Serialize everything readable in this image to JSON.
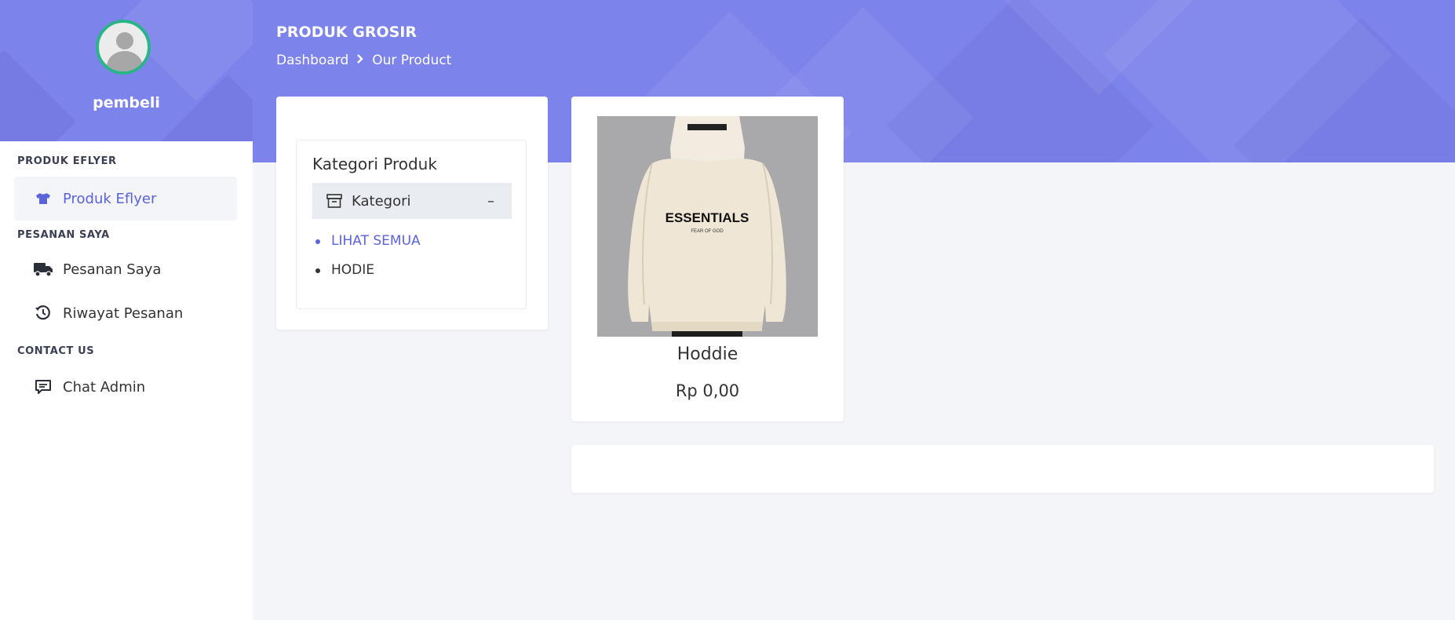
{
  "sidebar": {
    "username": "pembeli",
    "sections": [
      {
        "title": "PRODUK EFLYER"
      },
      {
        "title": "PESANAN SAYA"
      },
      {
        "title": "CONTACT US"
      }
    ],
    "items": [
      {
        "label": "Produk Eflyer",
        "icon": "shirt-icon",
        "active": true
      },
      {
        "label": "Pesanan Saya",
        "icon": "truck-icon"
      },
      {
        "label": "Riwayat Pesanan",
        "icon": "history-icon"
      },
      {
        "label": "Chat Admin",
        "icon": "chat-icon"
      }
    ]
  },
  "header": {
    "title": "PRODUK GROSIR",
    "breadcrumb": [
      "Dashboard",
      "Our Product"
    ]
  },
  "kategori": {
    "title": "Kategori Produk",
    "accordion_label": "Kategori",
    "toggle_symbol": "–",
    "items": [
      {
        "label": "LIHAT SEMUA",
        "active": true
      },
      {
        "label": "HODIE"
      }
    ]
  },
  "product": {
    "name": "Hoddie",
    "price": "Rp 0,00",
    "image_text": {
      "brand": "ESSENTIALS",
      "subtext": "FEAR OF GOD"
    }
  },
  "colors": {
    "banner": "#7c83ea",
    "accent": "#5b63d9",
    "avatar_ring": "#2bb38a"
  }
}
